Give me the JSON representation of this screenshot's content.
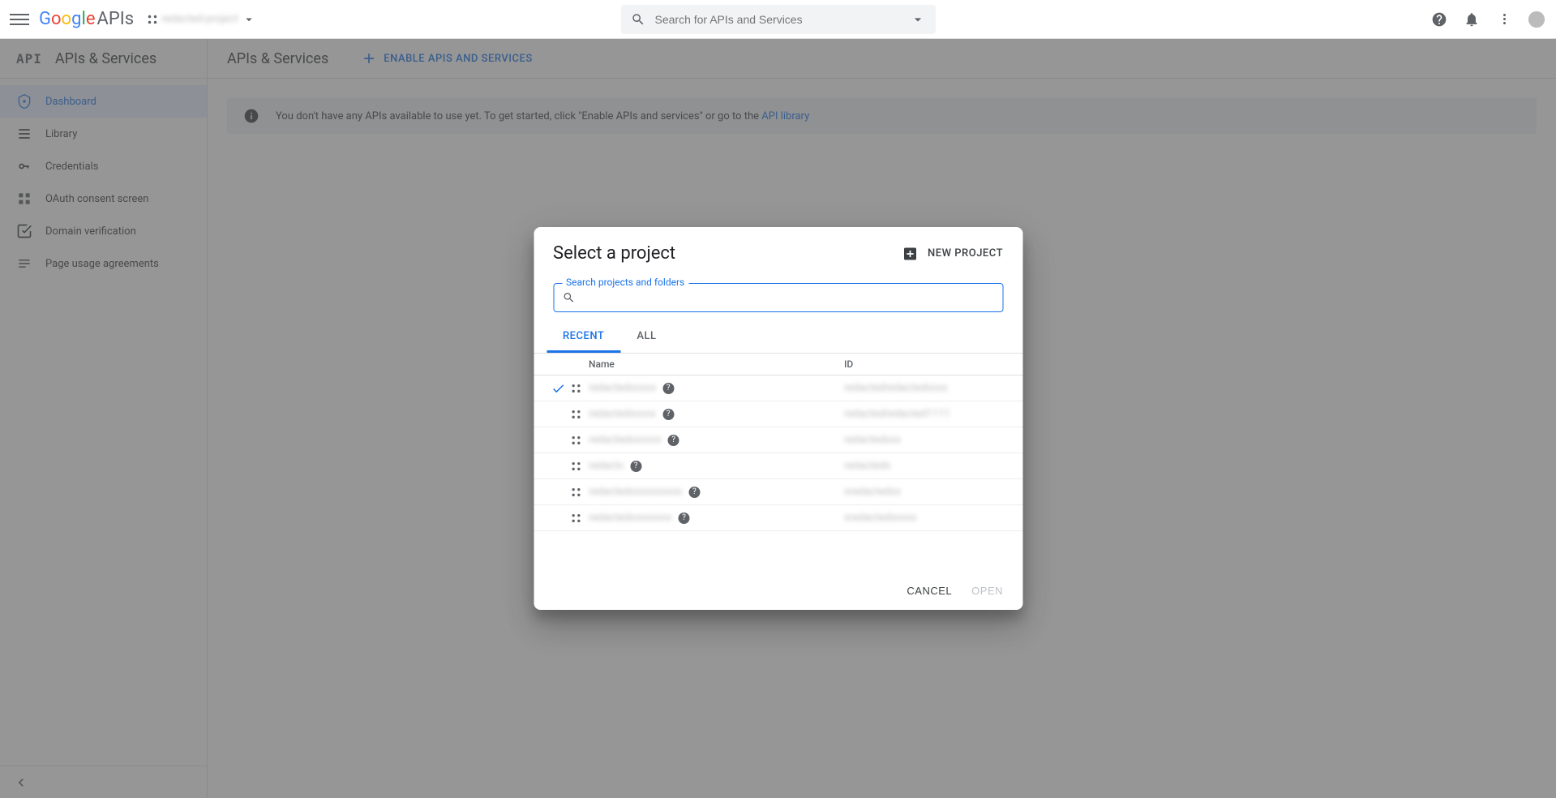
{
  "topbar": {
    "logo_suffix": "APIs",
    "project_switcher": "redacted-project",
    "search_placeholder": "Search for APIs and Services"
  },
  "sidebar": {
    "title": "APIs & Services",
    "items": [
      {
        "label": "Dashboard",
        "active": true
      },
      {
        "label": "Library"
      },
      {
        "label": "Credentials"
      },
      {
        "label": "OAuth consent screen"
      },
      {
        "label": "Domain verification"
      },
      {
        "label": "Page usage agreements"
      }
    ]
  },
  "content": {
    "title": "APIs & Services",
    "enable_button": "ENABLE APIS AND SERVICES",
    "banner": {
      "text": "You don't have any APIs available to use yet. To get started, click \"Enable APIs and services\" or go to the ",
      "link": "API library"
    }
  },
  "dialog": {
    "title": "Select a project",
    "new_project": "NEW PROJECT",
    "search_label": "Search projects and folders",
    "tabs": [
      "RECENT",
      "ALL"
    ],
    "active_tab": 0,
    "columns": {
      "name": "Name",
      "id": "ID"
    },
    "projects": [
      {
        "selected": true,
        "name": "redactedxxxxx",
        "id": "redactedredactedxxxx"
      },
      {
        "selected": false,
        "name": "redactedxxxxx",
        "id": "redactedredacted1111"
      },
      {
        "selected": false,
        "name": "redactedxxxxxx",
        "id": "redactedxxx"
      },
      {
        "selected": false,
        "name": "redactx",
        "id": "redactedx"
      },
      {
        "selected": false,
        "name": "redactedxxxxxxxxxx",
        "id": "xredactedxx"
      },
      {
        "selected": false,
        "name": "redactedxxxxxxxx",
        "id": "xredactedxxxxx"
      }
    ],
    "actions": {
      "cancel": "CANCEL",
      "open": "OPEN"
    }
  }
}
